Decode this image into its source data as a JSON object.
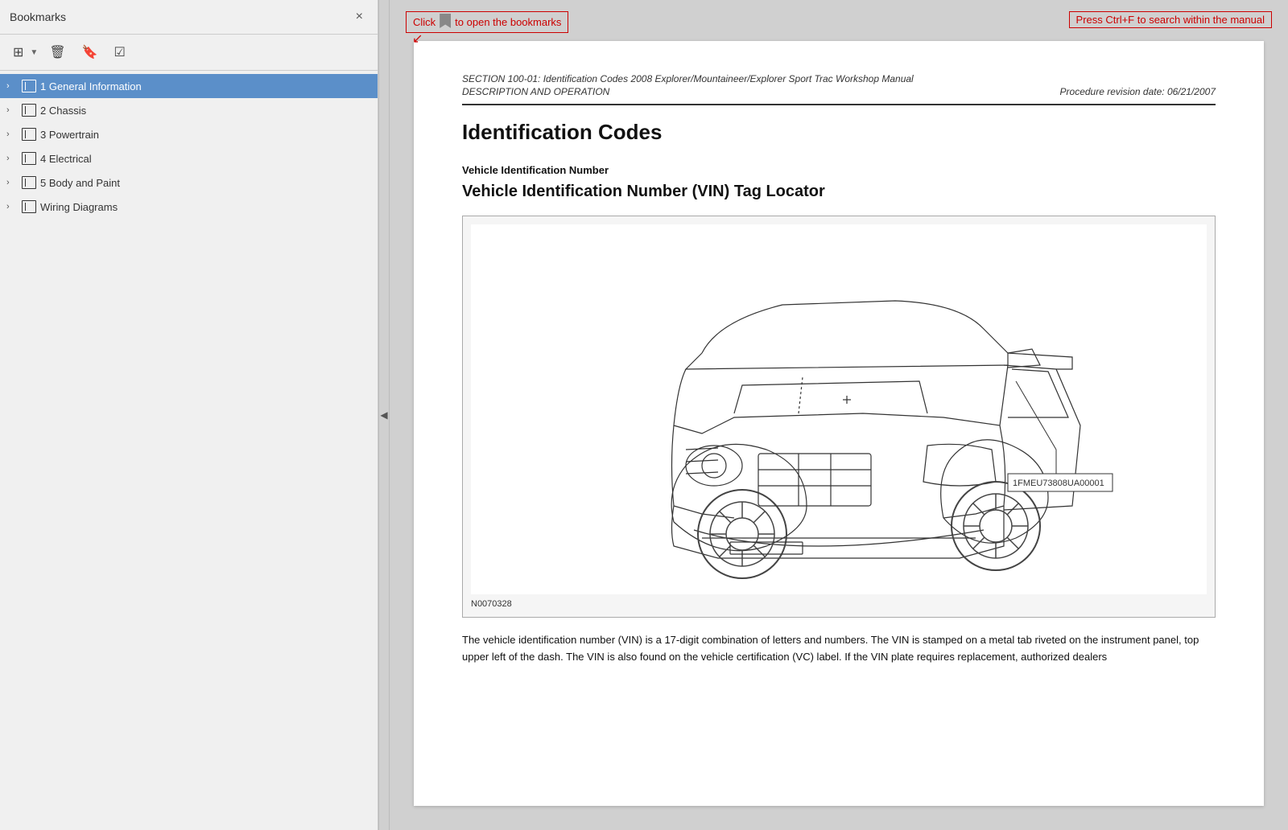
{
  "sidebar": {
    "title": "Bookmarks",
    "close_label": "×",
    "toolbar": {
      "expand_icon": "⊞",
      "delete_icon": "🗑",
      "bookmark_icon": "🔖",
      "add_icon": "☑"
    },
    "items": [
      {
        "id": "1",
        "label": "1 General Information",
        "selected": true,
        "expanded": false
      },
      {
        "id": "2",
        "label": "2 Chassis",
        "selected": false,
        "expanded": false
      },
      {
        "id": "3",
        "label": "3 Powertrain",
        "selected": false,
        "expanded": false
      },
      {
        "id": "4",
        "label": "4 Electrical",
        "selected": false,
        "expanded": false
      },
      {
        "id": "5",
        "label": "5 Body and Paint",
        "selected": false,
        "expanded": false
      },
      {
        "id": "6",
        "label": "Wiring Diagrams",
        "selected": false,
        "expanded": false
      }
    ]
  },
  "top_bar": {
    "hint_left": "Click",
    "hint_left_suffix": "to open the bookmarks",
    "hint_right": "Press Ctrl+F to search within the manual"
  },
  "document": {
    "section_header": "SECTION 100-01: Identification Codes   2008 Explorer/Mountaineer/Explorer Sport Trac Workshop Manual",
    "section_sub_left": "DESCRIPTION AND OPERATION",
    "section_sub_right": "Procedure revision date: 06/21/2007",
    "title": "Identification Codes",
    "vehicle_id_number_label": "Vehicle Identification Number",
    "section_title": "Vehicle Identification Number (VIN) Tag Locator",
    "figure_caption": "N0070328",
    "vin_sample": "1FMEU73808UA00001",
    "body_text": "The vehicle identification number (VIN) is a 17-digit combination of letters and numbers. The VIN is stamped on a metal tab riveted on the instrument panel, top upper left of the dash. The VIN is also found on the vehicle certification (VC) label. If the VIN plate requires replacement, authorized dealers"
  },
  "collapse_handle": {
    "arrow": "◀"
  }
}
